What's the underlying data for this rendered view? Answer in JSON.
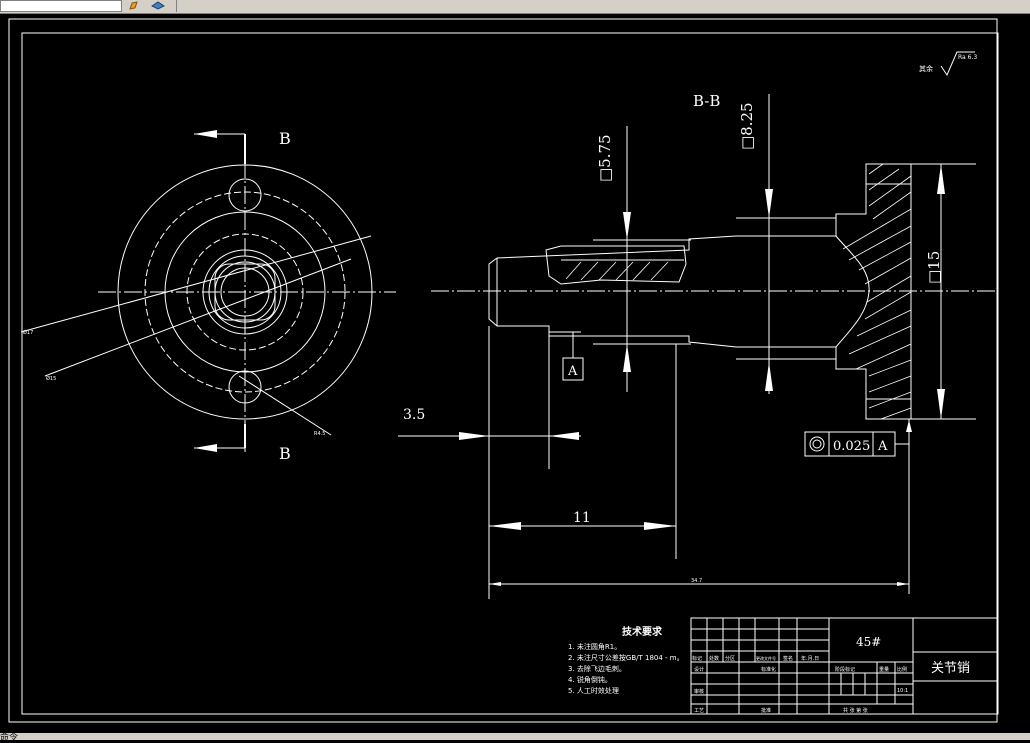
{
  "drawing": {
    "surface_mark": {
      "prefix": "其余",
      "value": "Ra 6.3"
    },
    "section_b_top": "B",
    "section_b_bottom": "B",
    "section_title": "B-B",
    "dim_square_575": "□5.75",
    "dim_square_825": "□8.25",
    "dim_square_15": "□15",
    "dim_35": "3.5",
    "dim_11": "11",
    "dim_overall": "34.7",
    "datum_label": "A",
    "tolerance": {
      "value": "0.025",
      "datum": "A"
    },
    "dia_small_1": "Ø17",
    "dia_small_2": "Ø15",
    "dia_small_3": "R4.5"
  },
  "notes": {
    "title": "技术要求",
    "items": [
      "1. 未注圆角R1。",
      "2. 未注尺寸公差按GB/T 1804 - m。",
      "3. 去除飞边毛刺。",
      "4. 锐角倒钝。",
      "5. 人工时效处理"
    ]
  },
  "title_block": {
    "material": "45#",
    "part_name": "关节销",
    "cell_labels": [
      "标记",
      "处数",
      "分区",
      "更改文件号",
      "签名",
      "年.月.日"
    ],
    "row_labels": [
      "设计",
      "审核",
      "工艺"
    ],
    "std_label": "标准化",
    "approve_label": "批准",
    "stage_labels": [
      "阶段标记",
      "重量",
      "比例"
    ],
    "scale": "10:1",
    "sheet": "共 张 第 张"
  },
  "status_text": "命令"
}
